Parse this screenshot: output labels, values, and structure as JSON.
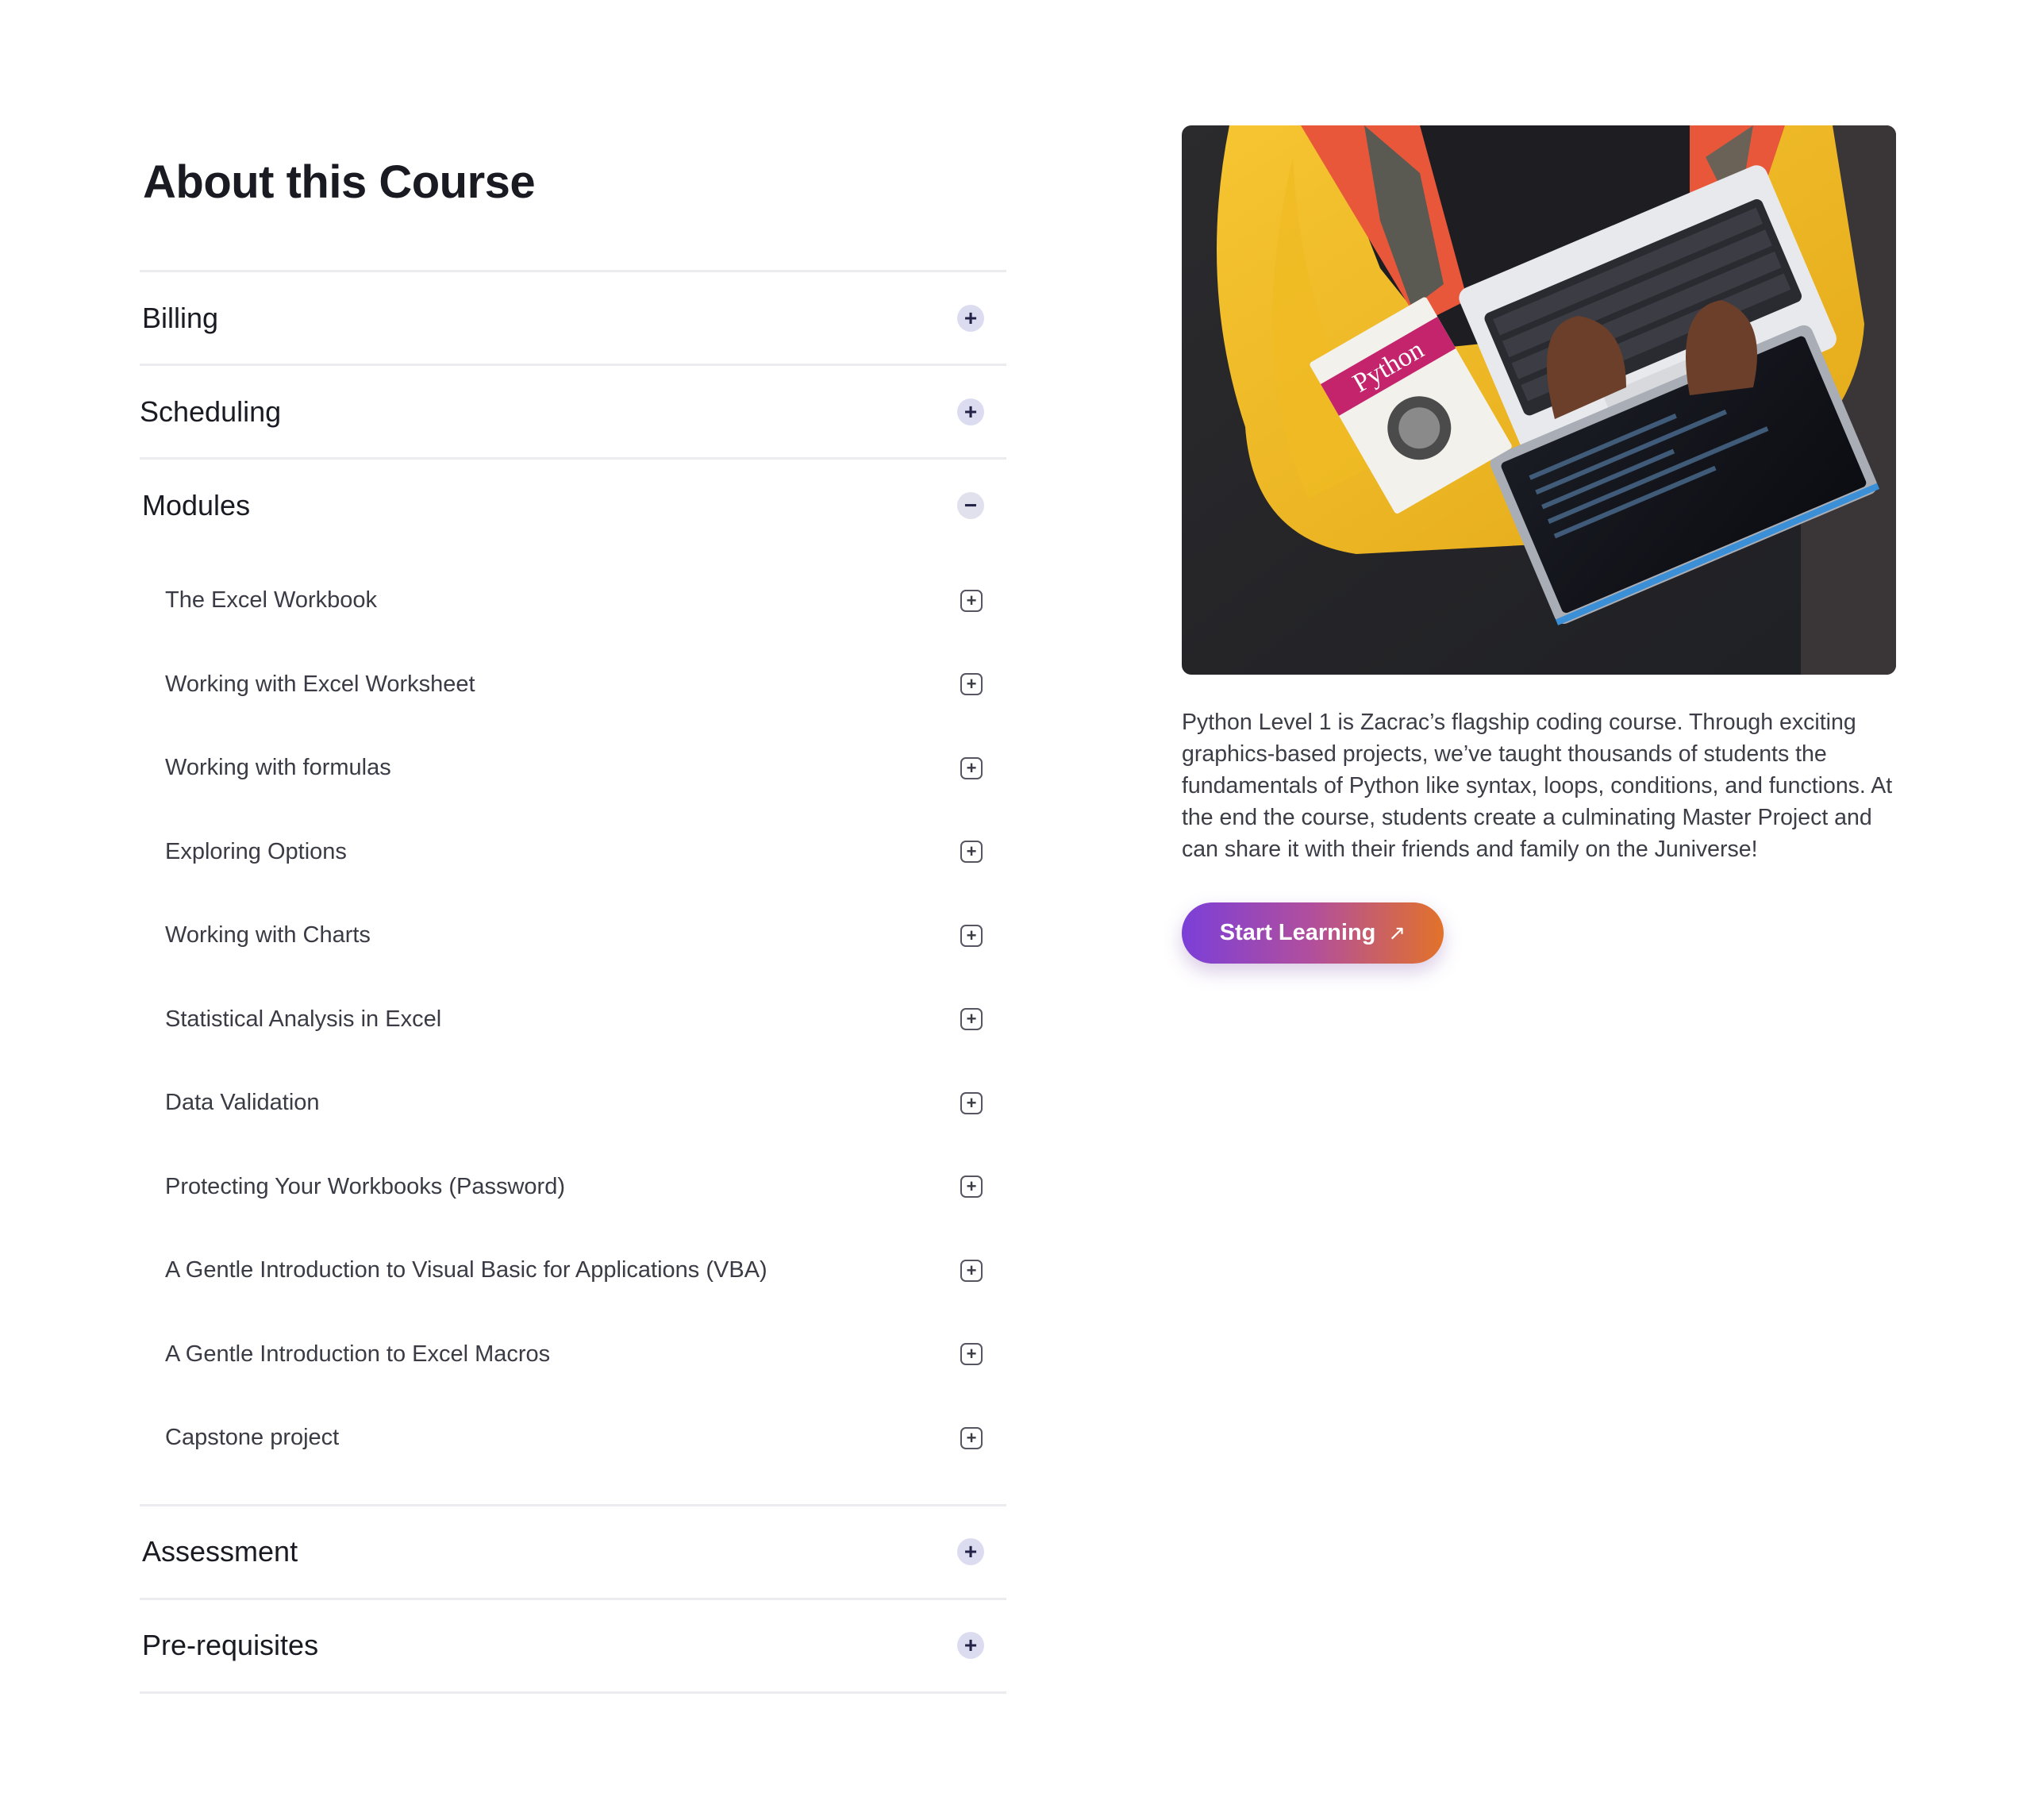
{
  "page_title": "About this Course",
  "accordion": {
    "sections_top": [
      {
        "title": "Billing",
        "toggle": "+"
      },
      {
        "title": "Scheduling",
        "toggle": "+"
      }
    ],
    "modules_section": {
      "title": "Modules",
      "toggle": "−",
      "expanded": true,
      "items": [
        {
          "label": "The Excel Workbook",
          "icon": "+"
        },
        {
          "label": "Working with Excel Worksheet",
          "icon": "+"
        },
        {
          "label": "Working with formulas",
          "icon": "+"
        },
        {
          "label": "Exploring Options",
          "icon": "+"
        },
        {
          "label": "Working with Charts",
          "icon": "+"
        },
        {
          "label": "Statistical Analysis in Excel",
          "icon": "+"
        },
        {
          "label": "Data Validation",
          "icon": "+"
        },
        {
          "label": "Protecting Your Workbooks (Password)",
          "icon": "+"
        },
        {
          "label": "A Gentle Introduction to Visual Basic for Applications (VBA)",
          "icon": "+"
        },
        {
          "label": "A Gentle Introduction to Excel Macros",
          "icon": "+"
        },
        {
          "label": "Capstone project",
          "icon": "+"
        }
      ]
    },
    "sections_bottom": [
      {
        "title": "Assessment",
        "toggle": "+"
      },
      {
        "title": "Pre-requisites",
        "toggle": "+"
      }
    ]
  },
  "hero_image": {
    "book_title": "Python"
  },
  "description": "Python Level 1 is Zacrac’s flagship coding course. Through exciting graphics-based projects, we’ve taught thousands of students the fundamentals of Python like syntax, loops, conditions, and functions. At the end the course, students create a culminating Master Project and can share it with their friends and family on the Juniverse!",
  "cta": {
    "label": "Start Learning",
    "arrow": "↗"
  },
  "colors": {
    "accent_start": "#7b3fd8",
    "accent_end": "#e2722a",
    "toggle_bg": "#dcdcf0",
    "divider": "#ececf0"
  }
}
